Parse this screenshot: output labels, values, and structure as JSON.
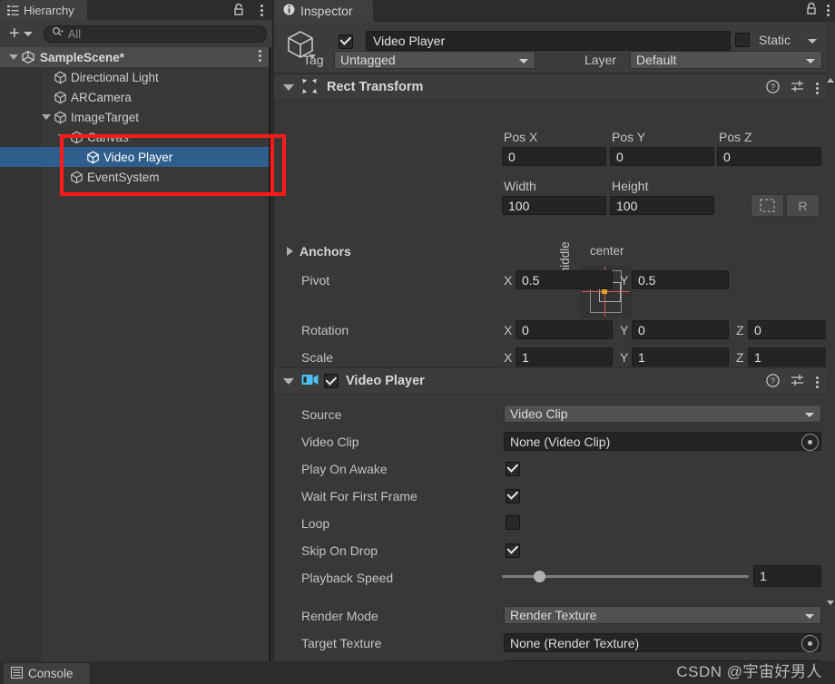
{
  "hierarchy": {
    "tab_label": "Hierarchy",
    "tab_icon": "hierarchy-list-icon",
    "lock_icon": "lock-open-icon",
    "menu_icon": "kebab-menu-icon",
    "add_label": "+",
    "search_placeholder": "All",
    "search_icon": "search-icon",
    "tree": [
      {
        "label": "SampleScene*",
        "depth": 0,
        "icon": "unity-scene-icon",
        "expanded": true,
        "selected": false,
        "is_scene": true
      },
      {
        "label": "Directional Light",
        "depth": 2,
        "icon": "gameobject-cube-icon",
        "expanded": null,
        "selected": false,
        "is_scene": false
      },
      {
        "label": "ARCamera",
        "depth": 2,
        "icon": "gameobject-cube-icon",
        "expanded": null,
        "selected": false,
        "is_scene": false
      },
      {
        "label": "ImageTarget",
        "depth": 2,
        "icon": "gameobject-cube-icon",
        "expanded": true,
        "selected": false,
        "is_scene": false
      },
      {
        "label": "Canvas",
        "depth": 3,
        "icon": "gameobject-cube-icon",
        "expanded": true,
        "selected": false,
        "is_scene": false
      },
      {
        "label": "Video Player",
        "depth": 4,
        "icon": "gameobject-cube-icon",
        "expanded": null,
        "selected": true,
        "is_scene": false
      },
      {
        "label": "EventSystem",
        "depth": 3,
        "icon": "gameobject-cube-icon",
        "expanded": null,
        "selected": false,
        "is_scene": false
      }
    ]
  },
  "inspector": {
    "tab_label": "Inspector",
    "tab_icon": "info-circle-icon",
    "lock_icon": "lock-open-icon",
    "menu_icon": "kebab-menu-icon",
    "object": {
      "icon": "gameobject-cube-icon",
      "enabled": true,
      "name": "Video Player",
      "static_label": "Static",
      "static_checked": false,
      "tag_label": "Tag",
      "tag_value": "Untagged",
      "layer_label": "Layer",
      "layer_value": "Default"
    },
    "rect_transform": {
      "title": "Rect Transform",
      "icon": "rect-transform-icon",
      "expanded": true,
      "help_icon": "help-question-icon",
      "preset_icon": "preset-sliders-icon",
      "menu_icon": "kebab-menu-icon",
      "anchor_preset": {
        "horizontal": "center",
        "vertical": "middle"
      },
      "pos_x_label": "Pos X",
      "pos_y_label": "Pos Y",
      "pos_z_label": "Pos Z",
      "pos_x": "0",
      "pos_y": "0",
      "pos_z": "0",
      "width_label": "Width",
      "height_label": "Height",
      "width": "100",
      "height": "100",
      "blueprint_button": "blueprint-mode-icon",
      "raw_button": "R",
      "anchors_label": "Anchors",
      "anchors_expanded": false,
      "pivot_label": "Pivot",
      "pivot_x": "0.5",
      "pivot_y": "0.5",
      "rotation_label": "Rotation",
      "rotation_x": "0",
      "rotation_y": "0",
      "rotation_z": "0",
      "scale_label": "Scale",
      "scale_x": "1",
      "scale_y": "1",
      "scale_z": "1",
      "axis_x": "X",
      "axis_y": "Y",
      "axis_z": "Z"
    },
    "video_player": {
      "title": "Video Player",
      "icon": "video-player-icon",
      "enabled": true,
      "expanded": true,
      "help_icon": "help-question-icon",
      "preset_icon": "preset-sliders-icon",
      "menu_icon": "kebab-menu-icon",
      "source_label": "Source",
      "source_value": "Video Clip",
      "video_clip_label": "Video Clip",
      "video_clip_value": "None (Video Clip)",
      "play_on_awake_label": "Play On Awake",
      "play_on_awake": true,
      "wait_for_first_frame_label": "Wait For First Frame",
      "wait_for_first_frame": true,
      "loop_label": "Loop",
      "loop": false,
      "skip_on_drop_label": "Skip On Drop",
      "skip_on_drop": true,
      "playback_speed_label": "Playback Speed",
      "playback_speed": "1",
      "playback_speed_pct": 15,
      "render_mode_label": "Render Mode",
      "render_mode_value": "Render Texture",
      "target_texture_label": "Target Texture",
      "target_texture_value": "None (Render Texture)"
    }
  },
  "console": {
    "tab_label": "Console",
    "tab_icon": "console-lines-icon"
  },
  "watermark": "CSDN @宇宙好男人",
  "colors": {
    "panel_bg": "#383838",
    "header_bg": "#3c3c3c",
    "tabbar_bg": "#2c2c2c",
    "selection_blue": "#2f5e8c",
    "annotation_red": "#ff1a1a",
    "video_icon_cyan": "#4cc2f1",
    "pivot_orange": "#e0a21a"
  }
}
